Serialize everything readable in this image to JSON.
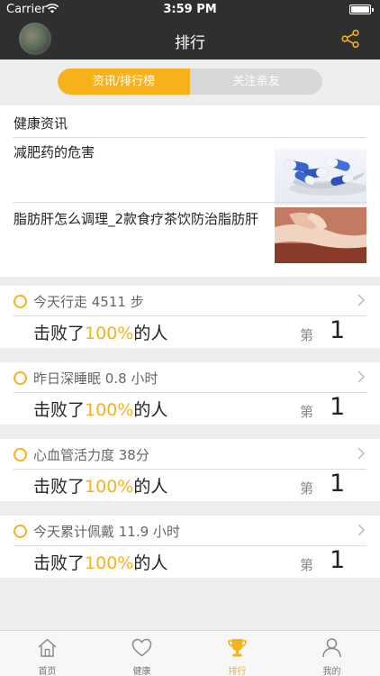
{
  "status_bar": {
    "carrier": "Carrier",
    "time": "3:59 PM"
  },
  "nav": {
    "title": "排行",
    "share_icon": "share-icon"
  },
  "segment": {
    "tabs": [
      {
        "label": "资讯/排行榜",
        "active": true
      },
      {
        "label": "关注亲友",
        "active": false
      }
    ]
  },
  "news": {
    "header": "健康资讯",
    "items": [
      {
        "title": "减肥药的危害"
      },
      {
        "title": "脂肪肝怎么调理_2款食疗茶饮防治脂肪肝"
      }
    ]
  },
  "rankings": [
    {
      "title": "今天行走 4511 步",
      "beat_prefix": "击败了",
      "beat_pct": "100%",
      "beat_suffix": "的人",
      "di": "第",
      "rank": "1"
    },
    {
      "title": "昨日深睡眠 0.8 小时",
      "beat_prefix": "击败了",
      "beat_pct": "100%",
      "beat_suffix": "的人",
      "di": "第",
      "rank": "1"
    },
    {
      "title": "心血管活力度 38分",
      "beat_prefix": "击败了",
      "beat_pct": "100%",
      "beat_suffix": "的人",
      "di": "第",
      "rank": "1"
    },
    {
      "title": "今天累计佩戴 11.9 小时",
      "beat_prefix": "击败了",
      "beat_pct": "100%",
      "beat_suffix": "的人",
      "di": "第",
      "rank": "1"
    }
  ],
  "tabbar": {
    "items": [
      {
        "label": "首页",
        "icon": "home-icon",
        "active": false
      },
      {
        "label": "健康",
        "icon": "heart-icon",
        "active": false
      },
      {
        "label": "排行",
        "icon": "trophy-icon",
        "active": true
      },
      {
        "label": "我的",
        "icon": "person-icon",
        "active": false
      }
    ]
  },
  "colors": {
    "accent": "#f5b21a",
    "nav_bg": "#2f2f30",
    "page_bg": "#eeeeee"
  }
}
